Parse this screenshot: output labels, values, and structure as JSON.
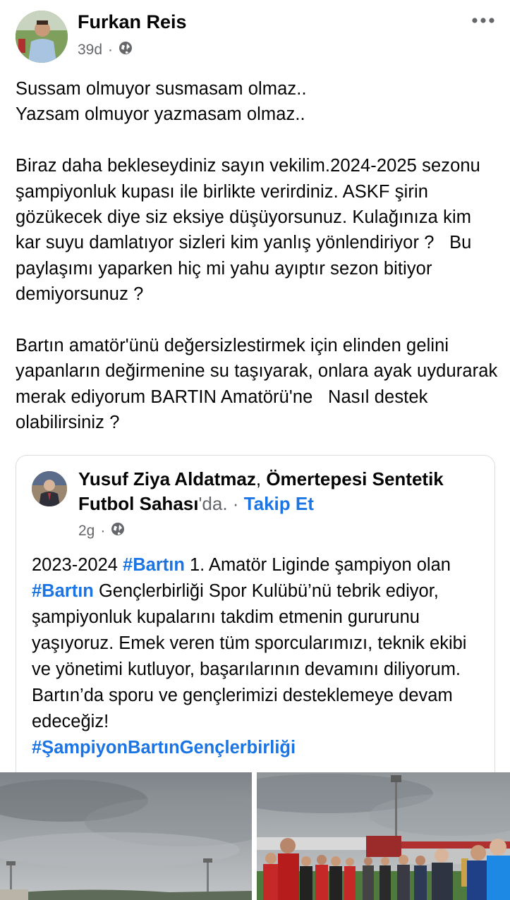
{
  "post": {
    "author": "Furkan Reis",
    "time": "39d",
    "privacy_icon": "globe-icon",
    "more_icon": "more-options-icon",
    "paragraphs": [
      "Sussam olmuyor susmasam olmaz..\nYazsam olmuyor yazmasam olmaz..",
      "Biraz daha bekleseydiniz sayın vekilim.2024-2025 sezonu şampiyonluk kupası ile birlikte verirdiniz. ASKF şirin gözükecek diye siz eksiye düşüyorsunuz. Kulağınıza kim kar suyu damlatıyor sizleri kim yanlış yönlendiriyor ?   Bu paylaşımı yaparken hiç mi yahu ayıptır sezon bitiyor demiyorsunuz ?",
      "Bartın amatör'ünü değersizlestirmek için elinden gelini yapanların değirmenine su taşıyarak, onlara ayak uydurarak  merak ediyorum BARTIN Amatörü'ne   Nasıl destek olabilirsiniz ?"
    ]
  },
  "shared_post": {
    "author": "Yusuf Ziya Aldatmaz",
    "separator": ", ",
    "location": "Ömertepesi Sentetik Futbol Sahası",
    "location_suffix": "'da.",
    "dot": " · ",
    "follow_label": "Takip Et",
    "time": "2g",
    "dot_time": " · ",
    "text": {
      "p1": "2023-2024 ",
      "tag1": "#Bartın",
      "p2": " 1. Amatör Liginde şampiyon olan ",
      "tag2": "#Bartın",
      "p3": " Gençlerbirliği Spor Kulübü’nü tebrik ediyor, şampiyonluk kupalarını takdim etmenin gururunu yaşıyoruz. Emek veren tüm sporcularımızı, teknik ekibi ve yönetimi kutluyor, başarılarının devamını diliyorum. Bartın’da sporu ve gençlerimizi desteklemeye devam edeceğiz!",
      "tag3": "#ŞampiyonBartınGençlerbirliği"
    }
  },
  "colors": {
    "text": "#050505",
    "secondary": "#65676b",
    "link": "#1b74e4",
    "border": "#dadde1"
  }
}
